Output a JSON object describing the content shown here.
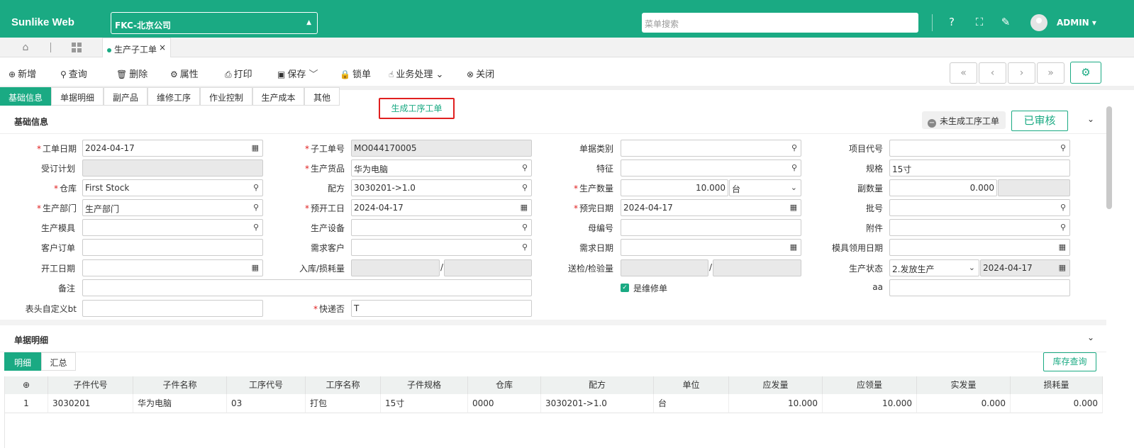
{
  "app": {
    "logo": "Sunlike Web",
    "company": "FKC-北京公司",
    "search_placeholder": "菜单搜索",
    "user": "ADMIN"
  },
  "tabs": {
    "active_doc": "生产子工单"
  },
  "toolbar": {
    "new": "新增",
    "query": "查询",
    "delete": "删除",
    "props": "属性",
    "print": "打印",
    "save": "保存",
    "lock": "锁单",
    "biz": "业务处理",
    "close": "关闭"
  },
  "subtabs": [
    "基础信息",
    "单据明细",
    "副产品",
    "维修工序",
    "作业控制",
    "生产成本",
    "其他"
  ],
  "popup": "生成工序工单",
  "basic": {
    "title": "基础信息",
    "not_generated": "未生成工序工单",
    "audited": "已审核"
  },
  "fields": {
    "order_date": {
      "label": "工单日期",
      "value": "2024-04-17"
    },
    "sub_no": {
      "label": "子工单号",
      "value": "MO044170005"
    },
    "doc_type": {
      "label": "单据类别",
      "value": ""
    },
    "project_code": {
      "label": "项目代号",
      "value": ""
    },
    "plan": {
      "label": "受订计划",
      "value": ""
    },
    "product": {
      "label": "生产货品",
      "value": "华为电脑"
    },
    "feature": {
      "label": "特征",
      "value": ""
    },
    "spec": {
      "label": "规格",
      "value": "15寸"
    },
    "warehouse": {
      "label": "仓库",
      "value": "First Stock"
    },
    "formula": {
      "label": "配方",
      "value": "3030201->1.0"
    },
    "qty": {
      "label": "生产数量",
      "value": "10.000",
      "unit": "台"
    },
    "sub_qty": {
      "label": "副数量",
      "value": "0.000"
    },
    "dept": {
      "label": "生产部门",
      "value": "生产部门"
    },
    "start_plan": {
      "label": "预开工日",
      "value": "2024-04-17"
    },
    "finish_plan": {
      "label": "预完日期",
      "value": "2024-04-17"
    },
    "batch": {
      "label": "批号",
      "value": ""
    },
    "mold": {
      "label": "生产模具",
      "value": ""
    },
    "equip": {
      "label": "生产设备",
      "value": ""
    },
    "parent_no": {
      "label": "母编号",
      "value": ""
    },
    "attach": {
      "label": "附件",
      "value": ""
    },
    "cust_order": {
      "label": "客户订单",
      "value": ""
    },
    "req_cust": {
      "label": "需求客户",
      "value": ""
    },
    "req_date": {
      "label": "需求日期",
      "value": ""
    },
    "mold_date": {
      "label": "模具领用日期",
      "value": ""
    },
    "start_date": {
      "label": "开工日期",
      "value": ""
    },
    "in_loss": {
      "label": "入库/损耗量"
    },
    "inspect": {
      "label": "送检/检验量"
    },
    "status": {
      "label": "生产状态",
      "value": "2.发放生产",
      "date": "2024-04-17"
    },
    "remark": {
      "label": "备注",
      "value": ""
    },
    "repair": {
      "label": "是维修单"
    },
    "aa": {
      "label": "aa",
      "value": ""
    },
    "custom_bt": {
      "label": "表头自定义bt",
      "value": ""
    },
    "express": {
      "label": "快递否",
      "value": "T"
    }
  },
  "detail": {
    "title": "单据明细",
    "tab_detail": "明细",
    "tab_sum": "汇总",
    "stock_btn": "库存查询",
    "columns": [
      "子件代号",
      "子件名称",
      "工序代号",
      "工序名称",
      "子件规格",
      "仓库",
      "配方",
      "单位",
      "应发量",
      "应领量",
      "实发量",
      "损耗量"
    ],
    "rows": [
      [
        "1",
        "3030201",
        "华为电脑",
        "03",
        "打包",
        "15寸",
        "0000",
        "3030201->1.0",
        "台",
        "10.000",
        "10.000",
        "0.000",
        "0.000"
      ]
    ]
  }
}
